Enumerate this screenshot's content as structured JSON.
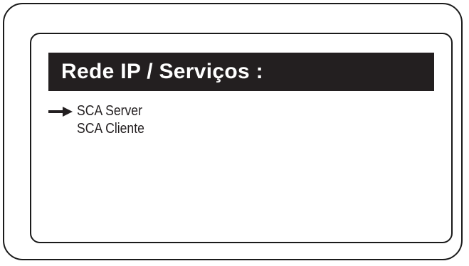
{
  "screen": {
    "title": "Rede IP / Serviços :",
    "menu_items": [
      {
        "label": "SCA Server",
        "selected": true
      },
      {
        "label": "SCA Cliente",
        "selected": false
      }
    ],
    "selection_icon": "right-arrow-icon"
  },
  "colors": {
    "title_bar_background": "#231f20",
    "title_text": "#ffffff",
    "frame_border": "#1a1a1a",
    "text": "#231f20"
  }
}
